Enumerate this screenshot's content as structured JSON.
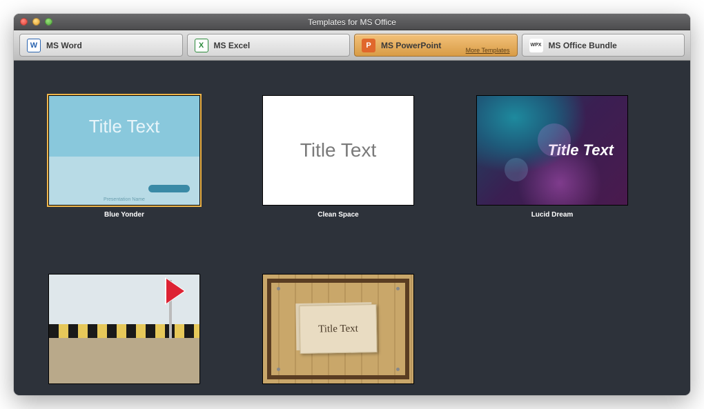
{
  "window": {
    "title": "Templates for MS Office"
  },
  "tabs": [
    {
      "label": "MS Word",
      "iconLetter": "W",
      "iconClass": "word"
    },
    {
      "label": "MS Excel",
      "iconLetter": "X",
      "iconClass": "excel"
    },
    {
      "label": "MS PowerPoint",
      "iconLetter": "P",
      "iconClass": "ppt",
      "active": true,
      "moreLink": "More Templates"
    },
    {
      "label": "MS Office Bundle",
      "iconLetter": "WPX",
      "iconClass": "bundle"
    }
  ],
  "templates": [
    {
      "name": "Blue Yonder",
      "selected": true,
      "placeholder": "Title Text",
      "footer": "Presentation Name"
    },
    {
      "name": "Clean Space",
      "placeholder": "Title Text"
    },
    {
      "name": "Lucid Dream",
      "placeholder": "Title Text"
    },
    {
      "name": "",
      "placeholder": ""
    },
    {
      "name": "",
      "placeholder": "Title Text"
    }
  ]
}
